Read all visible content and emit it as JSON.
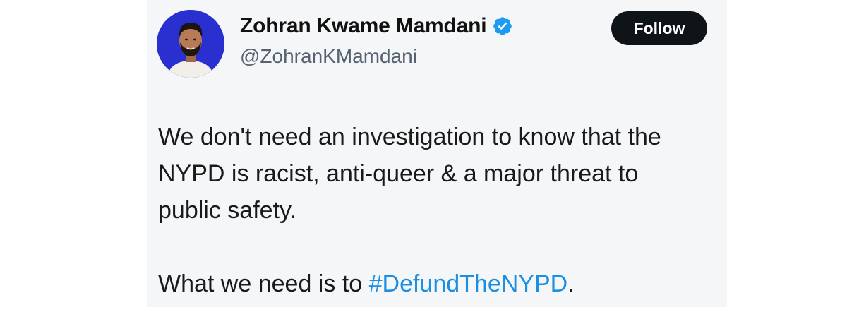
{
  "tweet": {
    "author": {
      "display_name": "Zohran Kwame Mamdani",
      "handle": "@ZohranKMamdani",
      "verified": true,
      "avatar_background": "#2a2fd0"
    },
    "follow_label": "Follow",
    "text": {
      "paragraph_1_line_1": "We don't need an investigation to know that the",
      "paragraph_1_line_2": "NYPD is racist, anti-queer & a major threat to",
      "paragraph_1_line_3": "public safety.",
      "paragraph_2_prefix": "What we need is to ",
      "paragraph_2_hashtag": "#DefundTheNYPD",
      "paragraph_2_suffix": "."
    }
  },
  "colors": {
    "card_background": "#f5f6f8",
    "follow_button": "#0f1419",
    "hashtag": "#1d8fe0",
    "verified_badge": "#1d9bf0",
    "handle_text": "#556270"
  },
  "icons": {
    "verified": "verified-badge-icon",
    "avatar": "avatar"
  }
}
